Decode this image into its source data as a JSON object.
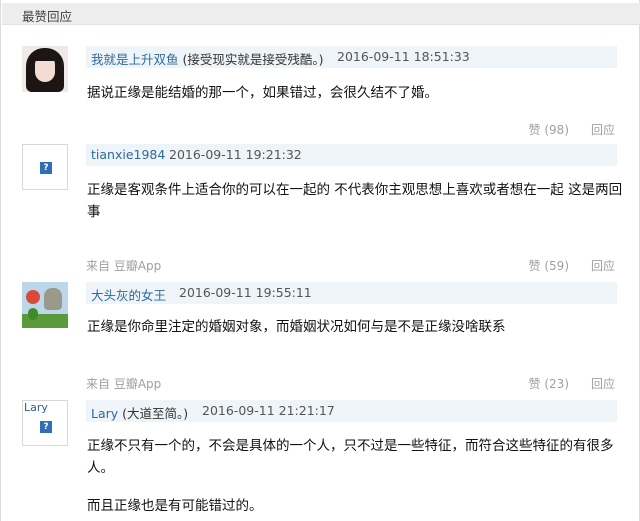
{
  "header": {
    "title": "最赞回应"
  },
  "comments": [
    {
      "author": "我就是上升双鱼",
      "signature": "(接受现实就是接受残酷。)",
      "time": "2016-09-11 18:51:33",
      "lines": [
        "据说正缘是能结婚的那一个，如果错过，会很久结不了婚。"
      ],
      "source": "",
      "likes": "赞 (98)",
      "reply": "回应",
      "avatar_type": "photo-girl"
    },
    {
      "author": "tianxie1984",
      "signature": "",
      "time": "2016-09-11 19:21:32",
      "lines": [
        "正缘是客观条件上适合你的可以在一起的 不代表你主观思想上喜欢或者想在一起 这是两回",
        "事"
      ],
      "source": "来自 豆瓣App",
      "likes": "赞 (59)",
      "reply": "回应",
      "avatar_type": "placeholder"
    },
    {
      "author": "大头灰的女王",
      "signature": "",
      "time": "2016-09-11 19:55:11",
      "lines": [
        "正缘是你命里注定的婚姻对象，而婚姻状况如何与是不是正缘没啥联系"
      ],
      "source": "来自 豆瓣App",
      "likes": "赞 (23)",
      "reply": "回应",
      "avatar_type": "game-image"
    },
    {
      "author": "Lary",
      "signature": "(大道至简。)",
      "time": "2016-09-11 21:21:17",
      "lines": [
        "正缘不只有一个的，不会是具体的一个人，只不过是一些特征，而符合这些特征的有很多",
        "人。",
        "",
        "而且正缘也是有可能错过的。"
      ],
      "source": "",
      "likes": "",
      "reply": "",
      "avatar_type": "placeholder-named",
      "avatar_label": "Lary"
    }
  ],
  "icons": {
    "placeholder": "question-mark-icon"
  },
  "colors": {
    "link": "#2d6a9f",
    "meta_bg": "#eef4f7",
    "muted": "#a0a0a0",
    "header_bg": "#ededed"
  }
}
